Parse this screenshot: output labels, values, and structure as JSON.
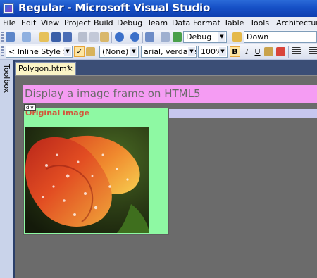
{
  "window": {
    "title": "Regular - Microsoft Visual Studio"
  },
  "menu": {
    "items": [
      "File",
      "Edit",
      "View",
      "Project",
      "Build",
      "Debug",
      "Team",
      "Data",
      "Format",
      "Table",
      "Tools",
      "Architecture"
    ]
  },
  "toolbar1": {
    "configuration": "Debug",
    "find": "Down"
  },
  "toolbar2": {
    "style": "< Inline Style >",
    "class_style": "(None)",
    "font": "arial, verdana",
    "font_size": "100%",
    "bold": "B",
    "italic": "I",
    "underline": "U"
  },
  "sidebar": {
    "toolbox_label": "Toolbox"
  },
  "document": {
    "tab_label": "Polygon.htm*",
    "tab_close": "×",
    "heading": "Display a image frame on HTML5",
    "div_tag": "div",
    "frame_label": "Original image"
  },
  "colors": {
    "heading_background": "#f59cf3",
    "frame_background": "#8ef9a3",
    "frame_label": "#d4543a",
    "div_region": "#c7c7ef"
  }
}
